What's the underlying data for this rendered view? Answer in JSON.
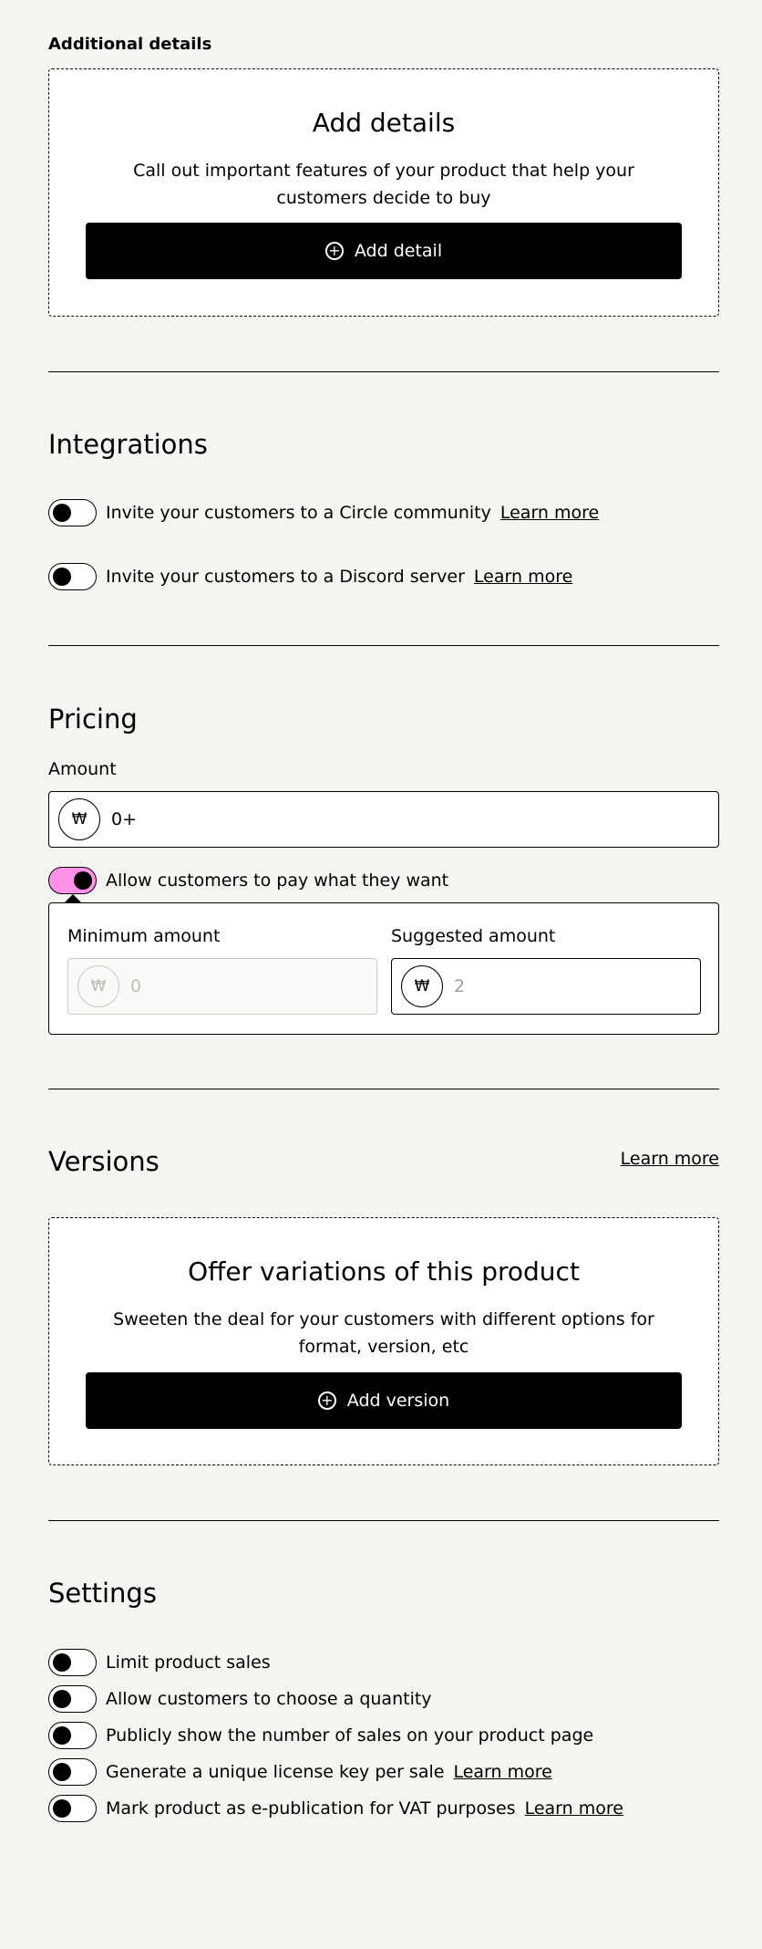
{
  "additional_details": {
    "label": "Additional details",
    "card_title": "Add details",
    "card_text": "Call out important features of your product that help your customers decide to buy",
    "button_label": "Add detail"
  },
  "integrations": {
    "title": "Integrations",
    "items": [
      {
        "label": "Invite your customers to a Circle community",
        "link": "Learn more",
        "enabled": false
      },
      {
        "label": "Invite your customers to a Discord server",
        "link": "Learn more",
        "enabled": false
      }
    ]
  },
  "pricing": {
    "title": "Pricing",
    "amount_label": "Amount",
    "currency_symbol": "₩",
    "amount_value": "0+",
    "pwyw_label": "Allow customers to pay what they want",
    "pwyw_enabled": true,
    "minimum_label": "Minimum amount",
    "minimum_value": "0",
    "suggested_label": "Suggested amount",
    "suggested_placeholder": "2"
  },
  "versions": {
    "title": "Versions",
    "learn_more": "Learn more",
    "card_title": "Offer variations of this product",
    "card_text": "Sweeten the deal for your customers with different options for format, version, etc",
    "button_label": "Add version"
  },
  "settings": {
    "title": "Settings",
    "items": [
      {
        "label": "Limit product sales",
        "link": "",
        "enabled": false
      },
      {
        "label": "Allow customers to choose a quantity",
        "link": "",
        "enabled": false
      },
      {
        "label": "Publicly show the number of sales on your product page",
        "link": "",
        "enabled": false
      },
      {
        "label": "Generate a unique license key per sale",
        "link": "Learn more",
        "enabled": false
      },
      {
        "label": "Mark product as e-publication for VAT purposes",
        "link": "Learn more",
        "enabled": false
      }
    ]
  },
  "colors": {
    "background": "#f4f4f0",
    "toggle_on": "#ff90e8",
    "button": "#000000"
  }
}
